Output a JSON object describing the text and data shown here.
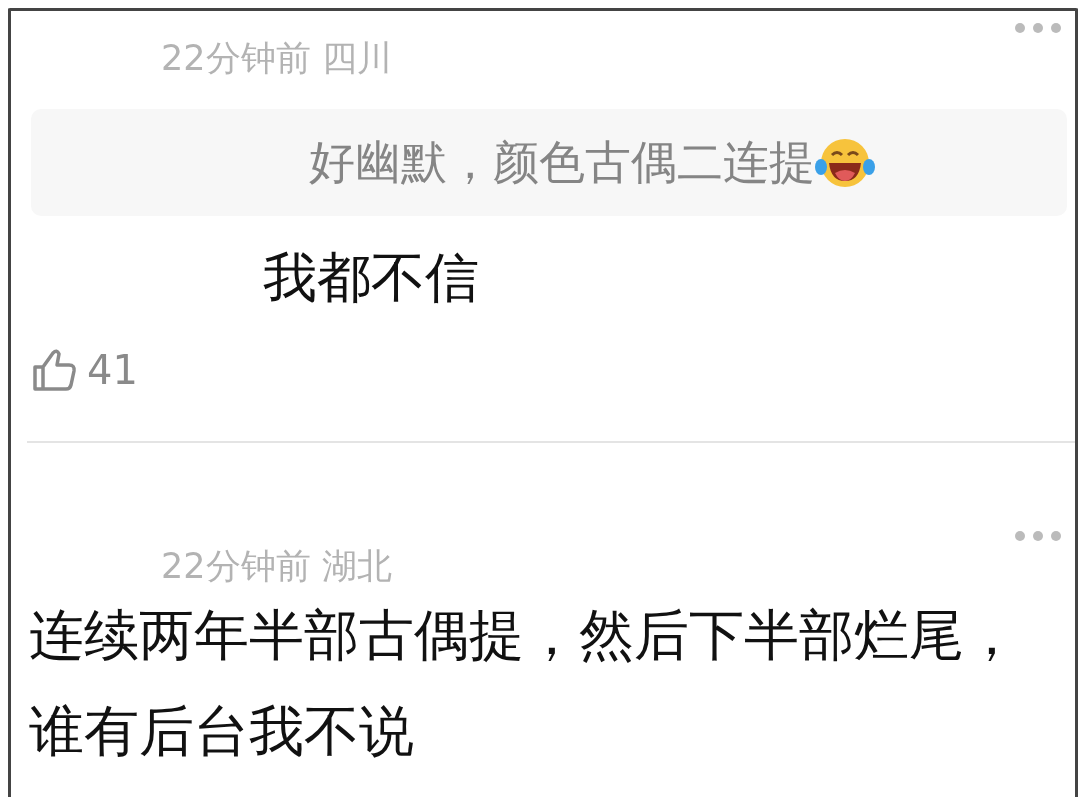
{
  "comments": [
    {
      "meta": "22分钟前 四川",
      "quote": "好幽默，颜色古偶二连提",
      "text_lines": [
        "我都不信"
      ],
      "kind": "reply",
      "likes": "41"
    },
    {
      "meta": "22分钟前 湖北",
      "text_lines": [
        "连续两年半部古偶提，然后下半部烂尾，",
        "谁有后台我不说"
      ],
      "kind": "comment"
    }
  ]
}
